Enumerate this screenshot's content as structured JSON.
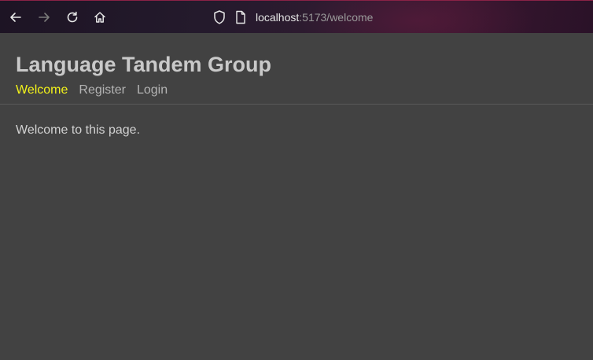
{
  "browser": {
    "url_host": "localhost",
    "url_path": ":5173/welcome",
    "icons": [
      "back-arrow-icon",
      "forward-arrow-icon",
      "reload-icon",
      "home-icon",
      "shield-icon",
      "page-icon"
    ]
  },
  "page": {
    "title": "Language Tandem Group",
    "nav": [
      {
        "label": "Welcome",
        "active": true
      },
      {
        "label": "Register",
        "active": false
      },
      {
        "label": "Login",
        "active": false
      }
    ],
    "body_text": "Welcome to this page."
  },
  "colors": {
    "background": "#424242",
    "active_link": "#f2f21a",
    "link": "#b4b4b4",
    "title": "#c9c9c9"
  }
}
